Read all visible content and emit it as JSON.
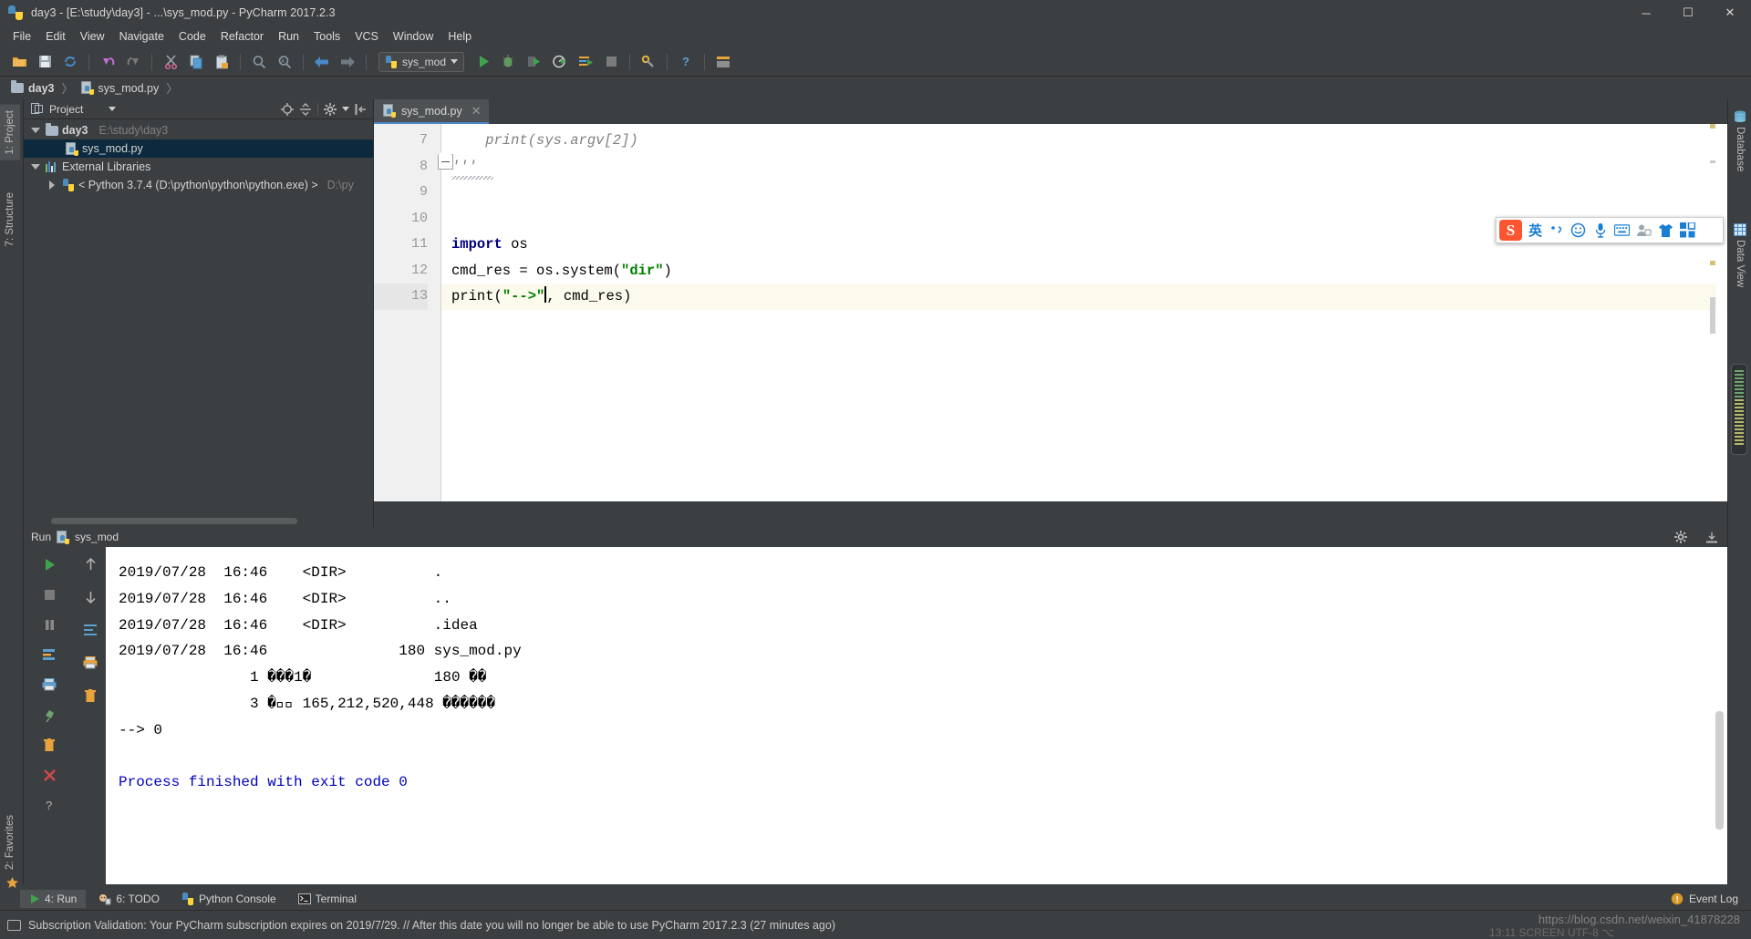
{
  "window": {
    "title": "day3 - [E:\\study\\day3] - ...\\sys_mod.py - PyCharm 2017.2.3",
    "minimize": "─",
    "maximize": "☐",
    "close": "✕"
  },
  "menubar": [
    {
      "label": "File"
    },
    {
      "label": "Edit"
    },
    {
      "label": "View"
    },
    {
      "label": "Navigate"
    },
    {
      "label": "Code"
    },
    {
      "label": "Refactor"
    },
    {
      "label": "Run"
    },
    {
      "label": "Tools"
    },
    {
      "label": "VCS"
    },
    {
      "label": "Window"
    },
    {
      "label": "Help"
    }
  ],
  "toolbar": {
    "run_config": "sys_mod",
    "icons": [
      "open-folder-icon",
      "save-icon",
      "sync-icon",
      "undo-icon",
      "redo-icon",
      "cut-icon",
      "copy-icon",
      "paste-icon",
      "find-icon",
      "replace-icon",
      "back-icon",
      "forward-icon"
    ],
    "run_icons": [
      "run-icon",
      "debug-icon",
      "coverage-icon",
      "profile-icon",
      "rerun-icon",
      "stop-icon"
    ],
    "settings_icon": "settings-icon",
    "help_icon": "help-icon",
    "more_icon": "more-icon"
  },
  "breadcrumb": {
    "items": [
      {
        "label": "day3",
        "icon": "folder-icon"
      },
      {
        "label": "sys_mod.py",
        "icon": "python-file-icon"
      }
    ],
    "separator": "〉"
  },
  "left_strip": {
    "tabs": [
      {
        "label": "1: Project",
        "selected": true
      },
      {
        "label": "7: Structure",
        "selected": false
      },
      {
        "label": "2: Favorites",
        "selected": false
      }
    ]
  },
  "right_strip": {
    "tabs": [
      {
        "label": "Database",
        "icon": "database-icon"
      },
      {
        "label": "Data View",
        "icon": "grid-icon"
      }
    ]
  },
  "project_panel": {
    "header": {
      "title": "Project",
      "icon": "project-icon",
      "caret": "▾",
      "locate_icon": "locate-icon",
      "collapse_icon": "collapse-all-icon",
      "settings_icon": "gear-icon",
      "hide_icon": "hide-icon"
    },
    "tree": [
      {
        "label": "day3",
        "detail": "E:\\study\\day3",
        "icon": "folder-icon",
        "expanded": true,
        "depth": 0,
        "bold": true,
        "selected": false
      },
      {
        "label": "sys_mod.py",
        "detail": "",
        "icon": "python-file-icon",
        "expanded": null,
        "depth": 1,
        "bold": false,
        "selected": true
      },
      {
        "label": "External Libraries",
        "detail": "",
        "icon": "libraries-icon",
        "expanded": true,
        "depth": 0,
        "bold": false,
        "selected": false
      },
      {
        "label": "< Python 3.7.4 (D:\\python\\python\\python.exe) >",
        "detail": "D:\\py",
        "icon": "python-icon",
        "expanded": false,
        "depth": 1,
        "bold": false,
        "selected": false
      }
    ]
  },
  "editor": {
    "tab": {
      "label": "sys_mod.py",
      "icon": "python-file-icon",
      "close": "✕"
    },
    "lines": [
      {
        "no": "7",
        "current": false,
        "highlight": false,
        "tokens": [
          {
            "t": "    print(sys.argv[2])",
            "c": "com"
          }
        ]
      },
      {
        "no": "8",
        "current": false,
        "highlight": false,
        "tokens": [
          {
            "t": "'''",
            "c": "com"
          }
        ]
      },
      {
        "no": "9",
        "current": false,
        "highlight": false,
        "tokens": [
          {
            "t": "",
            "c": "plain"
          }
        ]
      },
      {
        "no": "10",
        "current": false,
        "highlight": false,
        "tokens": [
          {
            "t": "",
            "c": "plain"
          }
        ]
      },
      {
        "no": "11",
        "current": false,
        "highlight": false,
        "tokens": [
          {
            "t": "import",
            "c": "kw"
          },
          {
            "t": " os",
            "c": "plain"
          }
        ]
      },
      {
        "no": "12",
        "current": false,
        "highlight": false,
        "tokens": [
          {
            "t": "cmd_res = os.system(",
            "c": "plain"
          },
          {
            "t": "\"dir\"",
            "c": "str"
          },
          {
            "t": ")",
            "c": "plain"
          }
        ]
      },
      {
        "no": "13",
        "current": true,
        "highlight": true,
        "tokens": [
          {
            "t": "print(",
            "c": "plain"
          },
          {
            "t": "\"-->\"",
            "c": "str"
          },
          {
            "t": ", cmd_res)",
            "c": "plain"
          }
        ]
      }
    ]
  },
  "run_panel": {
    "header": {
      "label": "Run",
      "config": "sys_mod",
      "icon": "python-file-icon",
      "gear_icon": "gear-icon",
      "hide_icon": "hide-icon"
    },
    "side_icons": [
      "run-icon",
      "stop-icon",
      "pause-icon",
      "restart-icon",
      "print-icon",
      "trash-icon",
      "pin-icon",
      "close-icon",
      "help-icon"
    ],
    "scroll_icons": [
      "scroll-up-icon",
      "scroll-down-icon",
      "soft-wrap-icon",
      "print-icon",
      "trash-icon"
    ],
    "console_lines": [
      {
        "text": "2019/07/28  16:46    <DIR>          .",
        "color": "black"
      },
      {
        "text": "2019/07/28  16:46    <DIR>          ..",
        "color": "black"
      },
      {
        "text": "2019/07/28  16:46    <DIR>          .idea",
        "color": "black"
      },
      {
        "text": "2019/07/28  16:46               180 sys_mod.py",
        "color": "black"
      },
      {
        "text": "               1 ���1�              180 ��",
        "color": "black"
      },
      {
        "text": "               3 ��ᬼ 165,212,520,448 ������",
        "color": "black"
      },
      {
        "text": "--> 0",
        "color": "black"
      },
      {
        "text": "",
        "color": "black"
      },
      {
        "text": "Process finished with exit code 0",
        "color": "blue"
      }
    ]
  },
  "bottom_tabs": [
    {
      "label": "4: Run",
      "icon": "run-icon",
      "selected": true
    },
    {
      "label": "6: TODO",
      "icon": "todo-icon",
      "selected": false
    },
    {
      "label": "Python Console",
      "icon": "python-icon",
      "selected": false
    },
    {
      "label": "Terminal",
      "icon": "terminal-icon",
      "selected": false
    }
  ],
  "event_log": {
    "label": "Event Log",
    "icon": "event-log-icon"
  },
  "statusbar": {
    "message": "Subscription Validation: Your PyCharm subscription expires on 2019/7/29. // After this date you will no longer be able to use PyCharm 2017.2.3 (27 minutes ago)",
    "icon": "monitor-icon"
  },
  "ime_bar": {
    "logo": "S",
    "mode": "英",
    "icons": [
      "punctuation-icon",
      "emoji-icon",
      "microphone-icon",
      "keyboard-icon",
      "user-icon",
      "skin-icon",
      "apps-icon"
    ]
  },
  "watermark": {
    "url": "https://blog.csdn.net/weixin_41878228",
    "overlay": "13:11  SCREEN  UTF-8  ⌥"
  },
  "colors": {
    "chrome": "#3c3f41",
    "accent": "#4a88c7",
    "selection": "#0d293e",
    "editor_bg": "#ffffff",
    "keyword": "#000080",
    "string": "#008000",
    "comment": "#808080",
    "console_blue": "#0000c0"
  }
}
